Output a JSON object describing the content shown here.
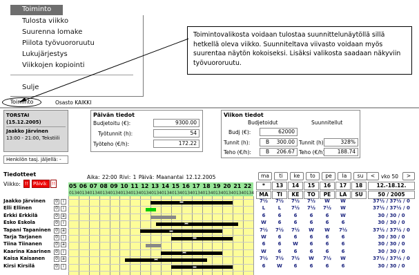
{
  "menu": {
    "title": "Toiminto",
    "items": [
      "Tulosta viikko",
      "Suurenna lomake",
      "Piilota työvuororuutu",
      "Lukujärjestys",
      "Viikkojen kopiointi"
    ],
    "close": "Sulje"
  },
  "callout": "Toimintovalikosta voidaan tulostaa suunnittelunäytöllä sillä hetkellä oleva viikko. Suunniteltava viivasto voidaan myös suurentaa näytön kokoiseksi. Lisäksi valikosta saadaan näkyviin työvuororuutu.",
  "topbar": {
    "toiminto": "Toiminto",
    "osasto": "Osasto  KAIKKI"
  },
  "person": {
    "day": "TORSTAI (15.12.2005)",
    "name": "Jaakko Järvinen",
    "shift": "13:00 - 21:00, Tekstiili"
  },
  "henkilon": "Henkilön tasj. jäljellä: -",
  "paivan": {
    "title": "Päivän tiedot",
    "budjetoitu_label": "Budjetoitu (€):",
    "budjetoitu": "9300.00",
    "tyotunnit_label": "Työtunnit (h):",
    "tyotunnit": "54",
    "tyoteho_label": "Työteho (€/h):",
    "tyoteho": "172.22"
  },
  "viikon": {
    "title": "Viikon tiedot",
    "budj_head": "Budjetoidut",
    "suun_head": "Suunnitellut",
    "budj_label": "Budj (€):",
    "budj": "62000",
    "tunnit_label": "Tunnit (h):",
    "tunnit_prefix": "B",
    "tunnit": "300.00",
    "teho_label": "Teho (€/h):",
    "teho_prefix": "B",
    "teho": "206.67",
    "s_tunnit_label": "Tunnit (h):",
    "s_tunnit": "328%",
    "s_teho_label": "Teho (€/h):",
    "s_teho": "188.74"
  },
  "tiedotteet": {
    "title": "Tiedotteet",
    "viikko": "Viikko:",
    "paiva": "Päivä:",
    "b1": "!!",
    "b2": "!!"
  },
  "gantt": {
    "info": "Aika: 22:00   Rivi: 1   Päivä: Maanantai 12.12.2005",
    "hours": [
      "05",
      "06",
      "07",
      "08",
      "09",
      "10",
      "11",
      "12",
      "13",
      "14",
      "15",
      "16",
      "17",
      "18",
      "19",
      "20",
      "21",
      "22"
    ]
  },
  "employees": [
    {
      "name": "Jaakko Järvinen",
      "c1": "0",
      "c2": "i"
    },
    {
      "name": "Elli Ellinen",
      "c1": "0",
      "c2": "i"
    },
    {
      "name": "Erkki Erkkilä",
      "c1": "0",
      "c2": "a"
    },
    {
      "name": "Esko Eskola",
      "c1": "0",
      "c2": "i"
    },
    {
      "name": "Tapani Tapaninen",
      "c1": "0",
      "c2": "a"
    },
    {
      "name": "Tarja Tarjanen",
      "c1": "0",
      "c2": "i"
    },
    {
      "name": "Tiina Tiinanen",
      "c1": "0",
      "c2": "a"
    },
    {
      "name": "Kaarina Kaarinen",
      "c1": "0",
      "c2": "i"
    },
    {
      "name": "Kaisa Kaisanen",
      "c1": "0",
      "c2": "a"
    },
    {
      "name": "Kirsi Kirsilä",
      "c1": "0",
      "c2": "i"
    }
  ],
  "week": {
    "days_btn": [
      "ma",
      "ti",
      "ke",
      "to",
      "pe",
      "la",
      "su"
    ],
    "prev": "<",
    "vko": "vko 50",
    "next": ">",
    "star": "*",
    "dates": [
      "13",
      "14",
      "15",
      "16",
      "17",
      "18"
    ],
    "range": "12.-18.12.",
    "days": [
      "MA",
      "TI",
      "KE",
      "TO",
      "PE",
      "LA",
      "SU"
    ],
    "weekyear": "50 / 2005",
    "rows": [
      [
        "7½",
        "7½",
        "7½",
        "7½",
        "W",
        "W",
        "37½ / 37½ / 0"
      ],
      [
        "L",
        "L",
        "7½",
        "7½",
        "7½",
        "W",
        "37½ / 37½ / 0"
      ],
      [
        "6",
        "6",
        "6",
        "6",
        "6",
        "W",
        "30 / 30 / 0"
      ],
      [
        "W",
        "6",
        "6",
        "6",
        "6",
        "6",
        "30 / 30 / 0"
      ],
      [
        "7½",
        "7½",
        "7½",
        "W",
        "W",
        "7½",
        "37½ / 37½ / 0"
      ],
      [
        "W",
        "6",
        "6",
        "6",
        "6",
        "6",
        "30 / 30 / 0"
      ],
      [
        "6",
        "6",
        "W",
        "6",
        "6",
        "6",
        "30 / 30 / 0"
      ],
      [
        "W",
        "6",
        "6",
        "6",
        "6",
        "6",
        "30 / 30 / 0"
      ],
      [
        "7½",
        "7½",
        "7½",
        "W",
        "7½",
        "W",
        "37½ / 37½ / 0"
      ],
      [
        "6",
        "W",
        "6",
        "6",
        "6",
        "6",
        "30 / 30 / 0"
      ]
    ]
  }
}
